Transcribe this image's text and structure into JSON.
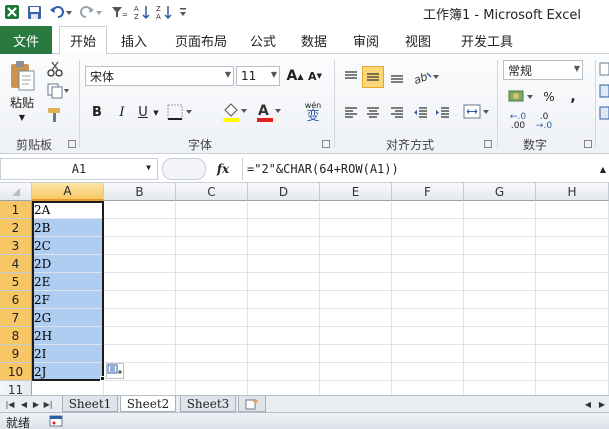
{
  "window": {
    "title": "工作簿1 - Microsoft Excel"
  },
  "ribbon": {
    "file_tab": "文件",
    "tabs": [
      "开始",
      "插入",
      "页面布局",
      "公式",
      "数据",
      "审阅",
      "视图",
      "开发工具"
    ],
    "active_tab": "开始",
    "clipboard": {
      "paste_label": "粘贴",
      "group_label": "剪贴板"
    },
    "font": {
      "font_name": "宋体",
      "font_size": "11",
      "group_label": "字体",
      "bold": "B",
      "italic": "I",
      "underline": "U",
      "wen_label": "wén",
      "wen_char": "变"
    },
    "alignment": {
      "group_label": "对齐方式"
    },
    "number": {
      "format": "常规",
      "percent": "%",
      "comma": ",",
      "group_label": "数字",
      "inc_decimal": ".00",
      "dec_decimal": ".0"
    }
  },
  "formula_bar": {
    "name_box": "A1",
    "fx": "fx",
    "formula": "=\"2\"&CHAR(64+ROW(A1))"
  },
  "columns": [
    "A",
    "B",
    "C",
    "D",
    "E",
    "F",
    "G",
    "H"
  ],
  "rows": [
    "1",
    "2",
    "3",
    "4",
    "5",
    "6",
    "7",
    "8",
    "9",
    "10",
    "11"
  ],
  "cells_a": [
    "2A",
    "2B",
    "2C",
    "2D",
    "2E",
    "2F",
    "2G",
    "2H",
    "2I",
    "2J"
  ],
  "sheets": [
    "Sheet1",
    "Sheet2",
    "Sheet3"
  ],
  "active_sheet": "Sheet2",
  "status": {
    "ready": "就绪"
  },
  "colors": {
    "file_tab": "#2a7a3f",
    "selection": "#aecdf0",
    "header_selected": "#f7c766"
  }
}
